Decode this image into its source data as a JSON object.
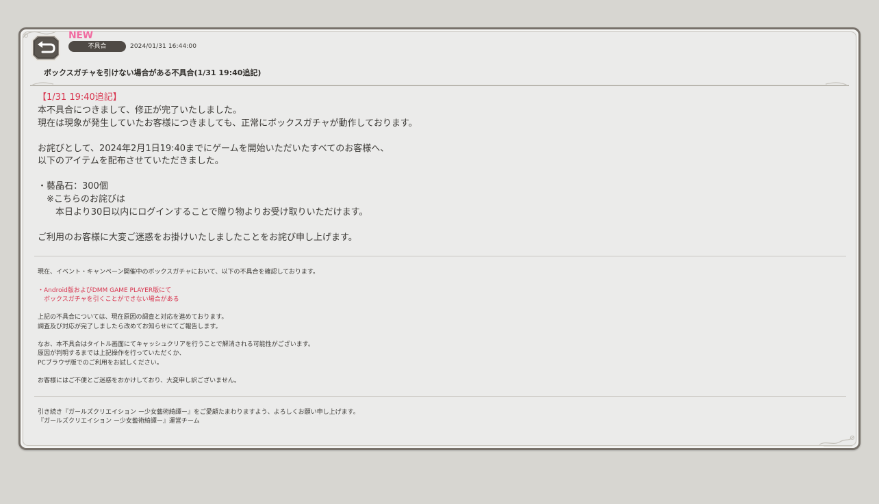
{
  "header": {
    "back_icon": "return-arrow-icon",
    "new_label": "NEW",
    "category": "不具合",
    "date": "2024/01/31 16:44:00",
    "title": "ボックスガチャを引けない場合がある不具合(1/31 19:40追記)"
  },
  "update": {
    "heading": "【1/31 19:40追記】",
    "line1": "本不具合につきまして、修正が完了いたしました。",
    "line2": "現在は現象が発生していたお客様につきましても、正常にボックスガチャが動作しております。",
    "line3": "お詫びとして、2024年2月1日19:40までにゲームを開始いただいたすべてのお客様へ、",
    "line4": "以下のアイテムを配布させていただきました。",
    "item": "・藝晶石：300個",
    "note1": "　※こちらのお詫びは",
    "note2": "　　本日より30日以内にログインすることで贈り物よりお受け取りいただけます。",
    "closing": "ご利用のお客様に大変ご迷惑をお掛けいたしましたことをお詫び申し上げます。"
  },
  "original": {
    "intro": "現在、イベント・キャンペーン開催中のボックスガチャにおいて、以下の不具合を確認しております。",
    "bug1": "・Android版およびDMM GAME PLAYER版にて",
    "bug2": "　ボックスガチャを引くことができない場合がある",
    "status1": "上記の不具合については、現在原因の調査と対応を進めております。",
    "status2": "調査及び対応が完了しましたら改めてお知らせにてご報告します。",
    "workaround1": "なお、本不具合はタイトル画面にてキャッシュクリアを行うことで解消される可能性がございます。",
    "workaround2": "原因が判明するまでは上記操作を行っていただくか、",
    "workaround3": "PCブラウザ版でのご利用をお試しください。",
    "apology": "お客様にはご不便とご迷惑をおかけしており、大変申し訳ございません。"
  },
  "footer": {
    "line1": "引き続き『ガールズクリエイション ー少女藝術綺譚ー』をご愛顧たまわりますよう、よろしくお願い申し上げます。",
    "line2": "『ガールズクリエイション ー少女藝術綺譚ー』運営チーム"
  },
  "colors": {
    "background": "#d7d6d1",
    "panel": "#ebebea",
    "frame": "#77716a",
    "accent_red": "#d8344e",
    "new_pink": "#f06ba0",
    "badge": "#4f4a45"
  }
}
